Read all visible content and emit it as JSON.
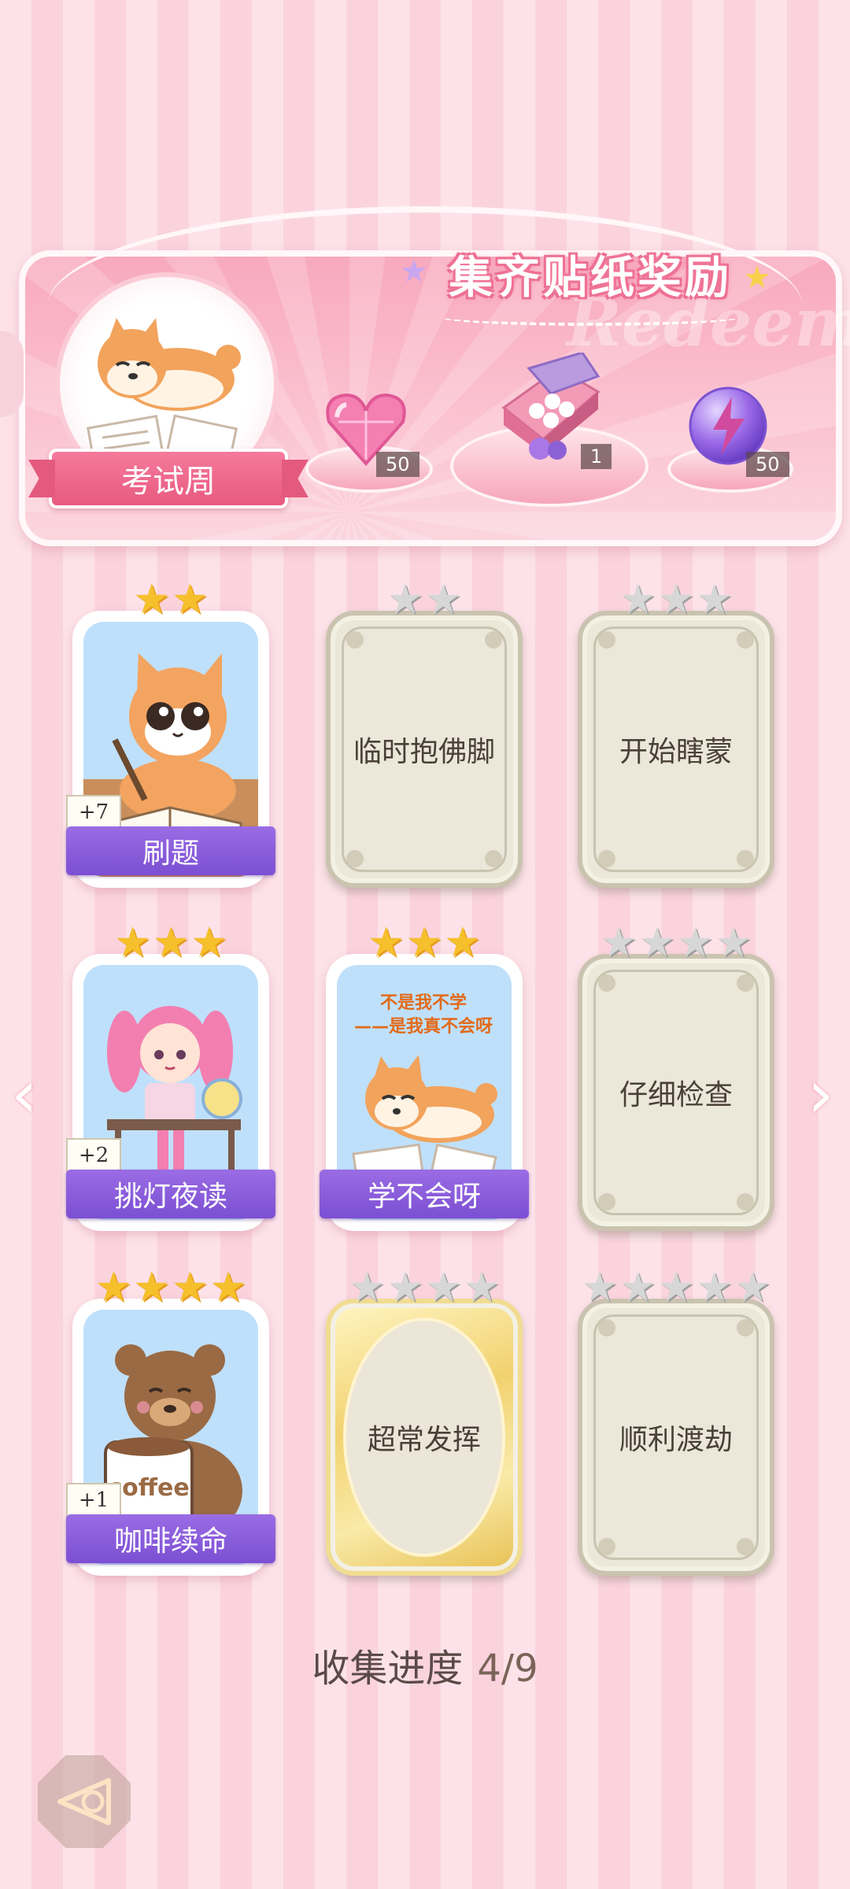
{
  "banner": {
    "title": "集齐贴纸奖励",
    "watermark": "Redeem",
    "theme_label": "考试周",
    "rewards": [
      {
        "icon": "heart-gem-icon",
        "count": "50"
      },
      {
        "icon": "gift-box-icon",
        "count": "1"
      },
      {
        "icon": "lightning-orb-icon",
        "count": "50"
      }
    ]
  },
  "cards": [
    {
      "name": "刷题",
      "stars": 2,
      "total_stars": 2,
      "unlocked": true,
      "bonus": "+7"
    },
    {
      "name": "临时抱佛脚",
      "stars": 0,
      "total_stars": 2,
      "unlocked": false
    },
    {
      "name": "开始瞎蒙",
      "stars": 0,
      "total_stars": 3,
      "unlocked": false
    },
    {
      "name": "挑灯夜读",
      "stars": 3,
      "total_stars": 3,
      "unlocked": true,
      "bonus": "+2"
    },
    {
      "name": "学不会呀",
      "stars": 3,
      "total_stars": 3,
      "unlocked": true,
      "caption_line1": "不是我不学",
      "caption_line2": "——是我真不会呀"
    },
    {
      "name": "仔细检查",
      "stars": 0,
      "total_stars": 4,
      "unlocked": false
    },
    {
      "name": "咖啡续命",
      "stars": 4,
      "total_stars": 4,
      "unlocked": true,
      "bonus": "+1",
      "cup_text": "coffee"
    },
    {
      "name": "超常发挥",
      "stars": 0,
      "total_stars": 4,
      "unlocked": false,
      "gold": true
    },
    {
      "name": "顺利渡劫",
      "stars": 0,
      "total_stars": 5,
      "unlocked": false
    }
  ],
  "progress": {
    "label": "收集进度",
    "value": "4/9"
  },
  "colors": {
    "label_purple": "#8a5cdc",
    "accent_pink": "#f57a9b",
    "star_gold": "#f6c02c"
  }
}
